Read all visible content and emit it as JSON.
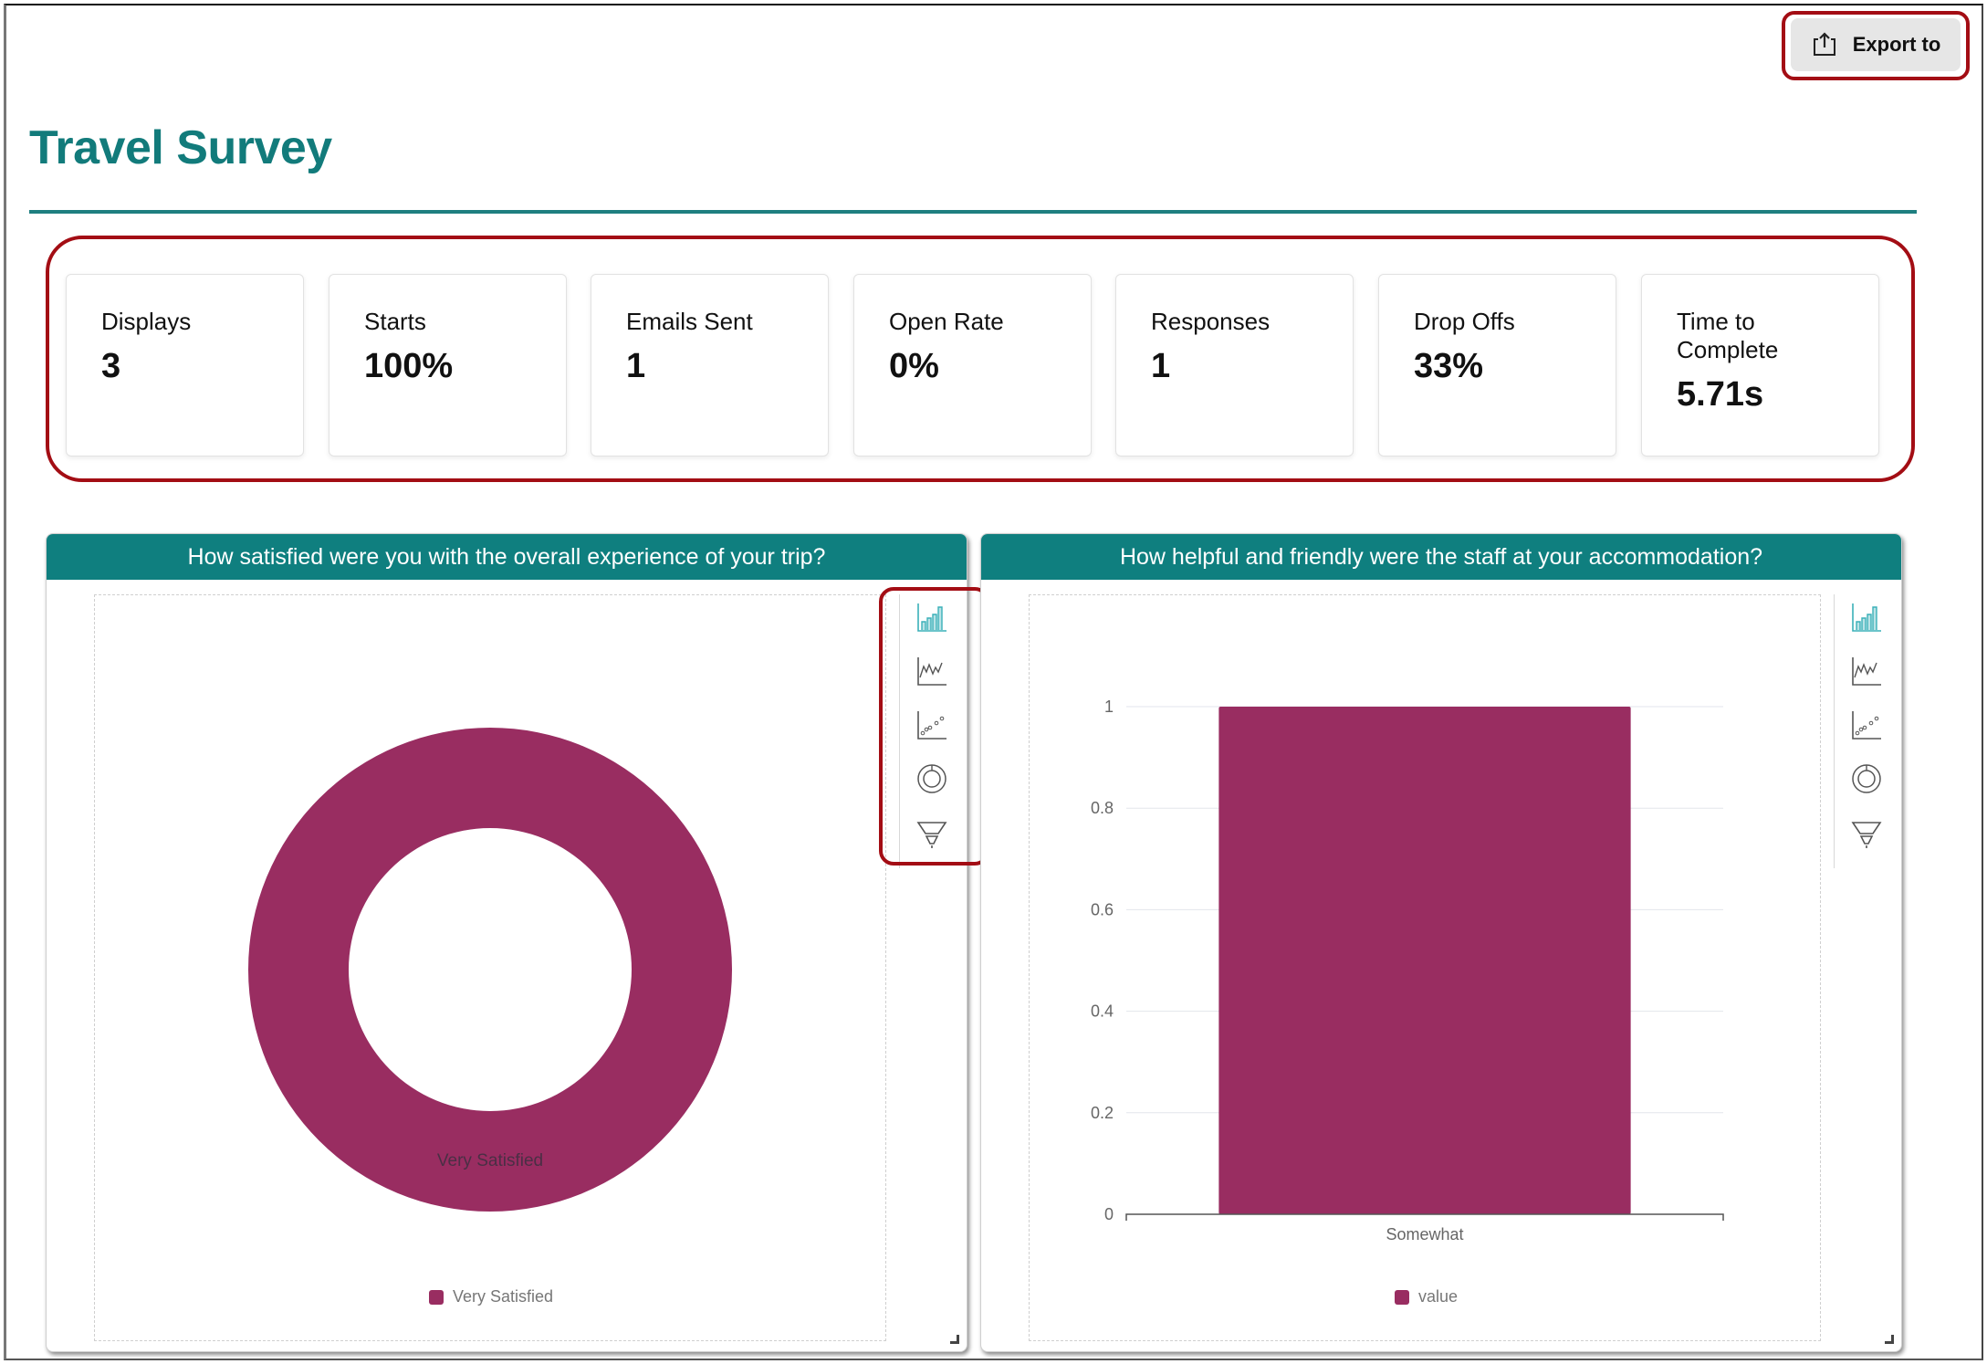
{
  "header": {
    "title": "Travel Survey",
    "export_label": "Export to"
  },
  "colors": {
    "accent": "#127b7b",
    "header_bg": "#0f7f7f",
    "series": "#992d61",
    "highlight": "#a30d14",
    "active_tool": "#3ab0b8"
  },
  "stats": [
    {
      "label": "Displays",
      "value": "3"
    },
    {
      "label": "Starts",
      "value": "100%"
    },
    {
      "label": "Emails Sent",
      "value": "1"
    },
    {
      "label": "Open Rate",
      "value": "0%"
    },
    {
      "label": "Responses",
      "value": "1"
    },
    {
      "label": "Drop Offs",
      "value": "33%"
    },
    {
      "label": "Time to Complete",
      "value": "5.71s"
    }
  ],
  "chart_tools": [
    {
      "name": "bar-chart-icon",
      "active": true
    },
    {
      "name": "line-chart-icon",
      "active": false
    },
    {
      "name": "scatter-chart-icon",
      "active": false
    },
    {
      "name": "donut-chart-icon",
      "active": false
    },
    {
      "name": "funnel-chart-icon",
      "active": false
    }
  ],
  "chart_data": [
    {
      "type": "pie",
      "variant": "donut",
      "title": "How satisfied were you with the overall experience of your trip?",
      "categories": [
        "Very Satisfied"
      ],
      "values": [
        1
      ],
      "slice_labels": [
        "Very Satisfied"
      ],
      "legend": [
        "Very Satisfied"
      ],
      "legend_position": "bottom"
    },
    {
      "type": "bar",
      "title": "How helpful and friendly were the staff at your accommodation?",
      "categories": [
        "Somewhat"
      ],
      "series": [
        {
          "name": "value",
          "values": [
            1
          ]
        }
      ],
      "xlabel": "",
      "ylabel": "",
      "ylim": [
        0,
        1
      ],
      "yticks": [
        "0",
        "0.2",
        "0.4",
        "0.6",
        "0.8",
        "1"
      ],
      "grid": true,
      "legend": [
        "value"
      ],
      "legend_position": "bottom"
    }
  ]
}
